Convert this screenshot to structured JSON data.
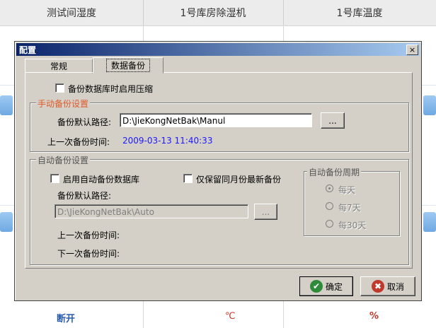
{
  "background": {
    "columns": [
      "测试间湿度",
      "1号库房除湿机",
      "1号库温度"
    ],
    "bottom_left": "断开",
    "bottom_unit_c": "℃",
    "bottom_unit_pct": "%"
  },
  "dialog": {
    "title": "配置",
    "close_glyph": "×",
    "tabs": [
      {
        "label": "常规",
        "active": false
      },
      {
        "label": "数据备份",
        "active": true
      }
    ],
    "compress_label": "备份数据库时启用压缩",
    "manual": {
      "group_label": "手动备份设置",
      "path_label": "备份默认路径:",
      "path_value": "D:\\JieKongNetBak\\Manul",
      "browse_label": "...",
      "last_label": "上一次备份时间:",
      "last_value": "2009-03-13 11:40:33"
    },
    "auto": {
      "group_label": "自动备份设置",
      "enable_label": "启用自动备份数据库",
      "keep_latest_label": "仅保留同月份最新备份",
      "path_label": "备份默认路径:",
      "path_value": "D:\\JieKongNetBak\\Auto",
      "browse_label": "...",
      "last_label": "上一次备份时间:",
      "next_label": "下一次备份时间:",
      "period": {
        "group_label": "自动备份周期",
        "options": [
          "每天",
          "每7天",
          "每30天"
        ],
        "selected": "每天"
      }
    },
    "ok_label": "确定",
    "cancel_label": "取消",
    "colors": {
      "title_start": "#0a246a",
      "title_end": "#a6caf0",
      "group_label": "#e05a2a",
      "timestamp": "#1a1aff"
    }
  }
}
